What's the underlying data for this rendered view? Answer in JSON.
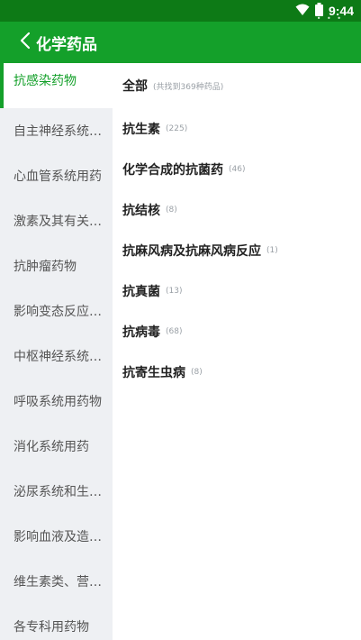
{
  "status_bar": {
    "time": "9:44",
    "dots": "• • •"
  },
  "header": {
    "title": "化学药品"
  },
  "sidebar": {
    "items": [
      {
        "label": "抗感染药物"
      },
      {
        "label": "自主神经系统用药物"
      },
      {
        "label": "心血管系统用药"
      },
      {
        "label": "激素及其有关药物"
      },
      {
        "label": "抗肿瘤药物"
      },
      {
        "label": "影响变态反应和免疫功能的药物"
      },
      {
        "label": "中枢神经系统用药物"
      },
      {
        "label": "呼吸系统用药物"
      },
      {
        "label": "消化系统用药"
      },
      {
        "label": "泌尿系统和生殖系统用药"
      },
      {
        "label": "影响血液及造血系统的药物"
      },
      {
        "label": "维生素类、营养类药物"
      },
      {
        "label": "各专科用药物"
      }
    ]
  },
  "content": {
    "items": [
      {
        "name": "全部",
        "count": "(共找到369种药品)"
      },
      {
        "name": "抗生素",
        "count": "(225)"
      },
      {
        "name": "化学合成的抗菌药",
        "count": "(46)"
      },
      {
        "name": "抗结核",
        "count": "(8)"
      },
      {
        "name": "抗麻风病及抗麻风病反应",
        "count": "(1)"
      },
      {
        "name": "抗真菌",
        "count": "(13)"
      },
      {
        "name": "抗病毒",
        "count": "(68)"
      },
      {
        "name": "抗寄生虫病",
        "count": "(8)"
      }
    ]
  },
  "colors": {
    "primary": "#14a02a",
    "status_bar": "#0d7a16",
    "sidebar_bg": "#eef0f3"
  },
  "icons": {
    "back": "chevron-left-icon",
    "wifi": "wifi-icon",
    "battery": "battery-icon"
  }
}
